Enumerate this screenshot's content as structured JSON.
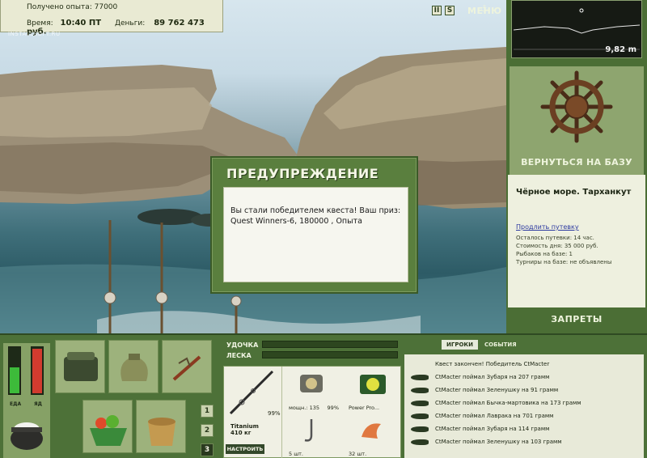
{
  "hud": {
    "exp_label": "Получено опыта:",
    "exp_value": "77000",
    "time_label": "Время:",
    "time_value": "10:40 ПТ",
    "money_label": "Деньги:",
    "money_value": "89 762 473 руб.",
    "watermark": "INSTALLSOFT.RU"
  },
  "controls": {
    "pause": "II",
    "sound": "S",
    "menu": "МЕНЮ"
  },
  "depth": {
    "value": "9,82 m"
  },
  "location": {
    "return_base": "ВЕРНУТЬСЯ НА БАЗУ",
    "name": "Чёрное море. Тарханкут",
    "extend_link": "Продлить путевку",
    "remaining": "Осталось путевки: 14 час.",
    "day_cost": "Стоимость дня: 35 000 руб.",
    "anglers": "Рыбаков на базе: 1",
    "tournaments": "Турниры на базе: не объявлены",
    "bans": "ЗАПРЕТЫ"
  },
  "dialog": {
    "title": "ПРЕДУПРЕЖДЕНИЕ",
    "message_line1": "Вы стали победителем квеста! Ваш приз:",
    "message_line2": "Quest Winners-6, 180000 , Опыта"
  },
  "status": {
    "food_label": "ЕДА",
    "poison_label": "ЯД",
    "food_level": 0.55,
    "poison_level": 0.95,
    "food_color": "#3dbb3a",
    "poison_color": "#d13b2f"
  },
  "slots": [
    "1",
    "2",
    "3"
  ],
  "active_slot": "3",
  "tackle": {
    "rod_label": "УДОЧКА",
    "line_label": "ЛЕСКА",
    "rod_name": "Titanium",
    "rod_weight": "410 кг",
    "rod_pct": "99%",
    "setup_button": "НАСТРОИТЬ",
    "reel_caption": "мощн.: 135",
    "reel_pct": "99%",
    "line_caption": "Power Pro...",
    "hook_caption": "5 шт.",
    "bait_caption": "32 шт."
  },
  "events": {
    "tab_players": "ИГРОКИ",
    "tab_events": "СОБЫТИЯ",
    "items": [
      "Квест закончен! Победитель CtMacter",
      "CtMacter поймал Зубаря на 207 грамм",
      "CtMacter поймал Зеленушку на 91 грамм",
      "CtMacter поймал Бычка-мартовика на 173 грамм",
      "CtMacter поймал Лаврака на 701 грамм",
      "CtMacter поймал Зубаря на 114 грамм",
      "CtMacter поймал Зеленушку на 103 грамм"
    ]
  }
}
